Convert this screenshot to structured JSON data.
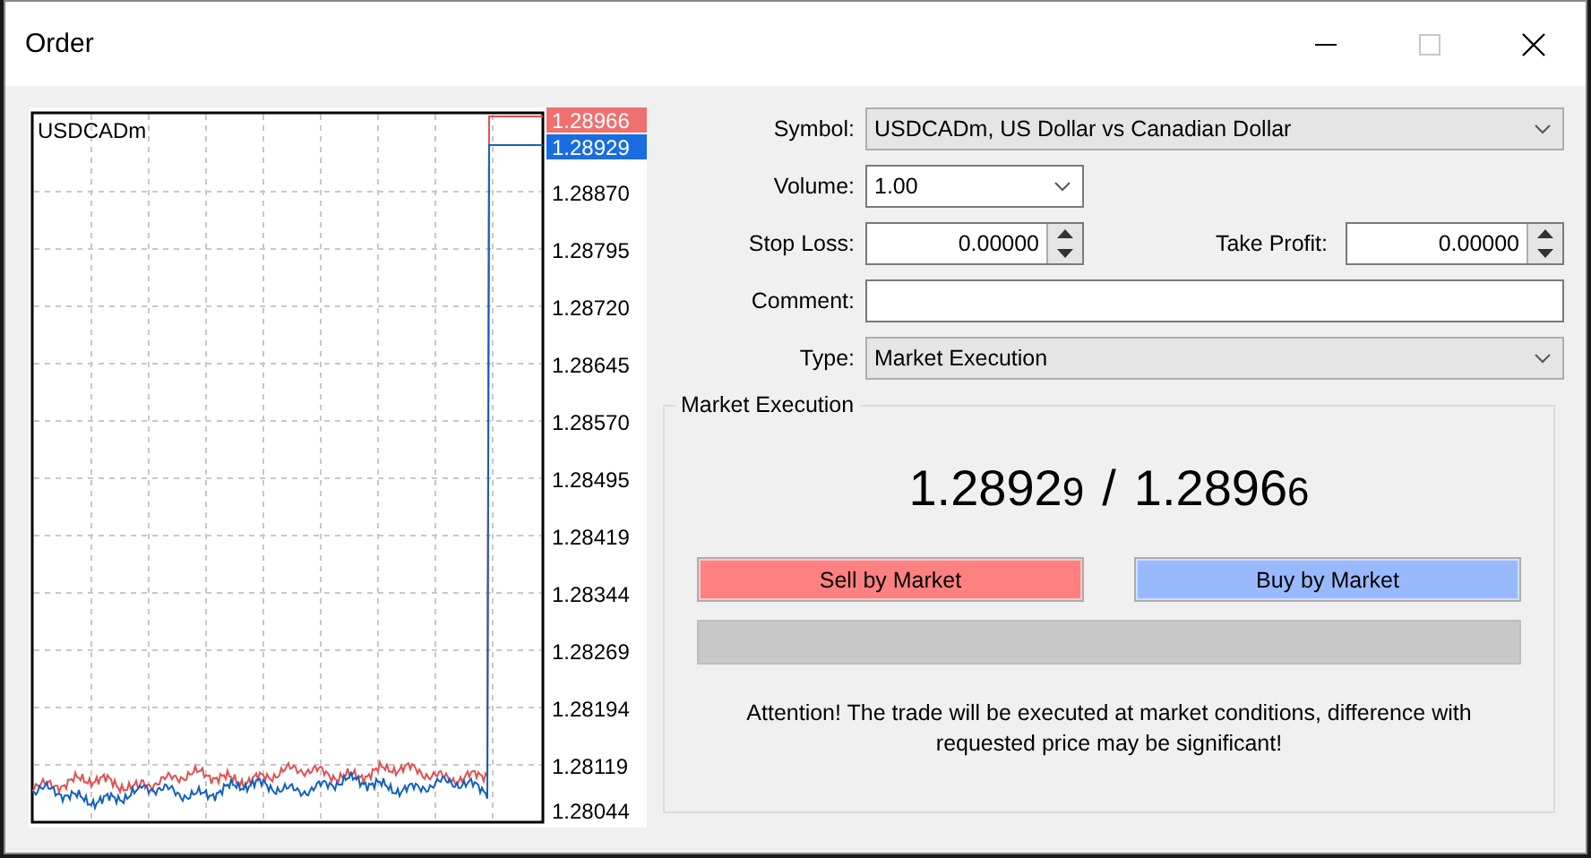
{
  "window": {
    "title": "Order",
    "maximize_disabled": true
  },
  "chart": {
    "symbol": "USDCADm",
    "ask_label": "1.28966",
    "bid_label": "1.28929",
    "price_labels": [
      "1.28870",
      "1.28795",
      "1.28720",
      "1.28645",
      "1.28570",
      "1.28495",
      "1.28419",
      "1.28344",
      "1.28269",
      "1.28194",
      "1.28119",
      "1.28044"
    ]
  },
  "form": {
    "symbol": {
      "label": "Symbol:",
      "value": "USDCADm, US Dollar vs Canadian Dollar"
    },
    "volume": {
      "label": "Volume:",
      "value": "1.00"
    },
    "stop_loss": {
      "label": "Stop Loss:",
      "value": "0.00000"
    },
    "take_profit": {
      "label": "Take Profit:",
      "value": "0.00000"
    },
    "comment": {
      "label": "Comment:"
    },
    "type": {
      "label": "Type:",
      "value": "Market Execution"
    }
  },
  "execution": {
    "title": "Market Execution",
    "bid": {
      "main": "1.2892",
      "last": "9"
    },
    "separator": "/",
    "ask": {
      "main": "1.2896",
      "last": "6"
    },
    "sell_button": "Sell by Market",
    "buy_button": "Buy by Market",
    "notice": "Attention! The trade will be executed at market conditions, difference with requested price may be significant!"
  }
}
